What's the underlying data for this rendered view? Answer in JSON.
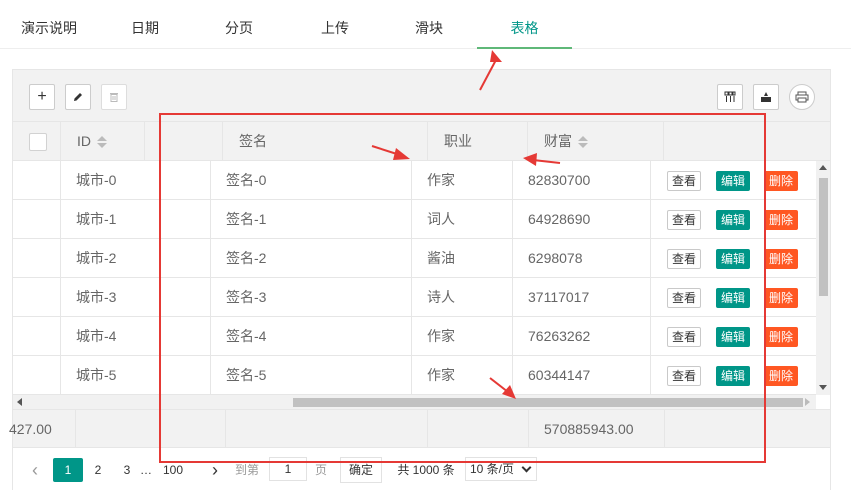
{
  "tabs": [
    "演示说明",
    "日期",
    "分页",
    "上传",
    "滑块",
    "表格"
  ],
  "toolbar": {
    "add": "+",
    "edit": "edit-icon",
    "delete": "trash-icon",
    "cols": "columns-icon",
    "export": "export-icon",
    "print": "print-icon"
  },
  "columns": {
    "id": "ID",
    "sign": "签名",
    "job": "职业",
    "wealth": "财富"
  },
  "rows": [
    {
      "city": "城市-0",
      "sign": "签名-0",
      "job": "作家",
      "wealth": "82830700"
    },
    {
      "city": "城市-1",
      "sign": "签名-1",
      "job": "词人",
      "wealth": "64928690"
    },
    {
      "city": "城市-2",
      "sign": "签名-2",
      "job": "酱油",
      "wealth": "6298078"
    },
    {
      "city": "城市-3",
      "sign": "签名-3",
      "job": "诗人",
      "wealth": "37117017"
    },
    {
      "city": "城市-4",
      "sign": "签名-4",
      "job": "作家",
      "wealth": "76263262"
    },
    {
      "city": "城市-5",
      "sign": "签名-5",
      "job": "作家",
      "wealth": "60344147"
    }
  ],
  "ops": {
    "view": "查看",
    "edit": "编辑",
    "del": "删除"
  },
  "totals": {
    "left": "427.00",
    "wealth": "570885943.00"
  },
  "pager": {
    "prev": "‹",
    "p1": "1",
    "p2": "2",
    "p3": "3",
    "ellipsis": "…",
    "p100": "100",
    "next": "›",
    "goto": "到第",
    "page_value": "1",
    "page_unit": "页",
    "confirm": "确定",
    "total": "共 1000 条",
    "per_page": "10 条/页"
  },
  "colors": {
    "accent": "#009688",
    "danger": "#FF5722",
    "annotation": "#e53935"
  }
}
